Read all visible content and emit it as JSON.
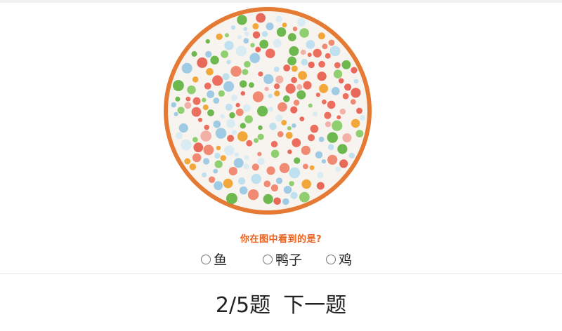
{
  "plate": {
    "description_icon": "ishihara-color-plate",
    "border_color": "#e57a34",
    "dot_colors": [
      "#9fcbe4",
      "#bfe0ef",
      "#6db84f",
      "#8fcf6f",
      "#e8685a",
      "#f08a72",
      "#f2a73a",
      "#d9ecf4"
    ],
    "figure_color": "#ec6e5e"
  },
  "question": {
    "text": "你在图中看到的是?"
  },
  "options": [
    {
      "label": "鱼"
    },
    {
      "label": "鸭子"
    },
    {
      "label": "鸡"
    }
  ],
  "footer": {
    "progress": "2/5题",
    "next_label": "下一题"
  }
}
